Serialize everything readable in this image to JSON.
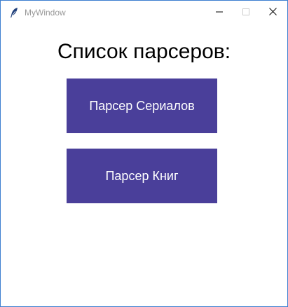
{
  "window": {
    "title": "MyWindow",
    "app_icon": "feather-icon",
    "controls": [
      "minimize-icon",
      "maximize-icon",
      "close-icon"
    ]
  },
  "main": {
    "heading": "Список парсеров:",
    "buttons": [
      {
        "label": "Парсер Сериалов"
      },
      {
        "label": "Парсер Книг"
      }
    ]
  },
  "colors": {
    "button_bg": "#4a3f9a",
    "button_text": "#ffffff",
    "heading_text": "#000000",
    "window_bg": "#ffffff",
    "window_border": "#3c7fd0"
  }
}
